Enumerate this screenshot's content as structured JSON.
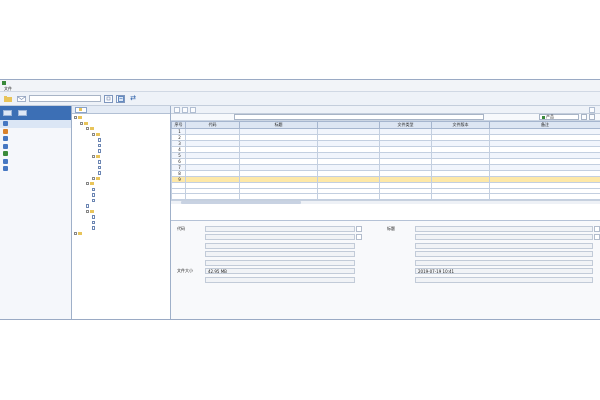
{
  "window": {
    "title": ""
  },
  "menu": {
    "items": [
      "文件",
      "",
      "",
      "",
      "",
      ""
    ]
  },
  "toolbar": {
    "search_placeholder": "",
    "page_icon": "document-icon",
    "refresh_icon": "refresh-icon"
  },
  "leftnav": {
    "items": [
      {
        "label": ""
      },
      {
        "label": ""
      },
      {
        "label": ""
      },
      {
        "label": ""
      },
      {
        "label": ""
      },
      {
        "label": ""
      },
      {
        "label": ""
      }
    ]
  },
  "tree": {
    "tab_label": "",
    "rows": [
      {
        "label": "",
        "depth": 0,
        "kind": "folder"
      },
      {
        "label": "",
        "depth": 1,
        "kind": "folder"
      },
      {
        "label": "",
        "depth": 2,
        "kind": "folder"
      },
      {
        "label": "",
        "depth": 3,
        "kind": "folder"
      },
      {
        "label": "",
        "depth": 4,
        "kind": "doc"
      },
      {
        "label": "",
        "depth": 4,
        "kind": "doc"
      },
      {
        "label": "",
        "depth": 4,
        "kind": "doc"
      },
      {
        "label": "",
        "depth": 3,
        "kind": "folder"
      },
      {
        "label": "",
        "depth": 4,
        "kind": "doc",
        "selected": true
      },
      {
        "label": "",
        "depth": 4,
        "kind": "doc"
      },
      {
        "label": "",
        "depth": 4,
        "kind": "doc"
      },
      {
        "label": "",
        "depth": 3,
        "kind": "folder"
      },
      {
        "label": "",
        "depth": 2,
        "kind": "folder"
      },
      {
        "label": "",
        "depth": 3,
        "kind": "doc"
      },
      {
        "label": "",
        "depth": 3,
        "kind": "doc"
      },
      {
        "label": "",
        "depth": 3,
        "kind": "doc"
      },
      {
        "label": "",
        "depth": 2,
        "kind": "doc"
      },
      {
        "label": "",
        "depth": 2,
        "kind": "folder"
      },
      {
        "label": "",
        "depth": 3,
        "kind": "doc"
      },
      {
        "label": "",
        "depth": 3,
        "kind": "doc"
      },
      {
        "label": "",
        "depth": 3,
        "kind": "doc"
      },
      {
        "label": "",
        "depth": 0,
        "kind": "folder"
      }
    ]
  },
  "main_toolbar": {
    "buttons": [
      "",
      "",
      ""
    ],
    "right_button": ""
  },
  "breadcrumb": {
    "path": "",
    "select_value": "产品",
    "buttons": [
      "",
      ""
    ]
  },
  "table": {
    "columns": [
      "序号",
      "代码",
      "标题",
      "",
      "文件类型",
      "文件版本",
      "备注"
    ],
    "rows": [
      [
        "1",
        "",
        "",
        "",
        "",
        "",
        ""
      ],
      [
        "2",
        "",
        "",
        "",
        "",
        "",
        ""
      ],
      [
        "3",
        "",
        "",
        "",
        "",
        "",
        ""
      ],
      [
        "4",
        "",
        "",
        "",
        "",
        "",
        ""
      ],
      [
        "5",
        "",
        "",
        "",
        "",
        "",
        ""
      ],
      [
        "6",
        "",
        "",
        "",
        "",
        "",
        ""
      ],
      [
        "7",
        "",
        "",
        "",
        "",
        "",
        ""
      ],
      [
        "8",
        "",
        "",
        "",
        "",
        "",
        ""
      ],
      [
        "9",
        "",
        "",
        "",
        "",
        "",
        ""
      ]
    ],
    "selected_row": 8
  },
  "props": {
    "left": [
      {
        "label": "代码",
        "value": ""
      },
      {
        "label": "",
        "value": ""
      },
      {
        "label": "",
        "value": ""
      },
      {
        "label": "",
        "value": ""
      },
      {
        "label": "",
        "value": ""
      },
      {
        "label": "文件大小",
        "value": "42.95 MB"
      },
      {
        "label": "",
        "value": ""
      }
    ],
    "right": [
      {
        "label": "标题",
        "value": ""
      },
      {
        "label": "",
        "value": ""
      },
      {
        "label": "",
        "value": ""
      },
      {
        "label": "",
        "value": ""
      },
      {
        "label": "",
        "value": ""
      },
      {
        "label": "",
        "value": "2019-07-19 10:41"
      },
      {
        "label": "",
        "value": ""
      }
    ]
  },
  "colors": {
    "accent": "#3c6fb5",
    "selection": "#fde8a8",
    "link_text": "#1b2fb0"
  }
}
